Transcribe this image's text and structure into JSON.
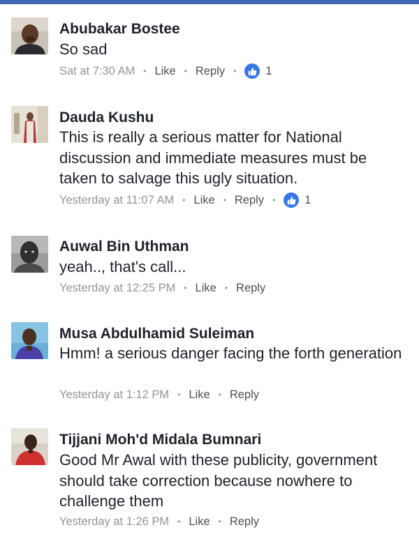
{
  "comments": [
    {
      "name": "Abubakar Bostee",
      "text": "So sad",
      "time": "Sat at 7:30 AM",
      "like_label": "Like",
      "reply_label": "Reply",
      "reactions": "1",
      "reaction_icon": "thumbs-up-icon"
    },
    {
      "name": "Dauda Kushu",
      "text": "This is really a serious matter for National discussion and immediate measures must be taken to salvage this ugly situation.",
      "time": "Yesterday at 11:07 AM",
      "like_label": "Like",
      "reply_label": "Reply",
      "reactions": "1",
      "reaction_icon": "thumbs-up-icon"
    },
    {
      "name": "Auwal Bin Uthman",
      "text": "yeah.., that's call...",
      "time": "Yesterday at 12:25 PM",
      "like_label": "Like",
      "reply_label": "Reply"
    },
    {
      "name": "Musa Abdulhamid Suleiman",
      "text": "Hmm! a serious danger facing the forth generation",
      "time": "Yesterday at 1:12 PM",
      "like_label": "Like",
      "reply_label": "Reply"
    },
    {
      "name": "Tijjani Moh'd Midala Bumnari",
      "text": "Good Mr Awal with these publicity, government should take correction because nowhere to challenge them",
      "time": "Yesterday at 1:26 PM",
      "like_label": "Like",
      "reply_label": "Reply"
    }
  ],
  "separator": "•",
  "colors": {
    "accent": "#4267b2",
    "like_badge": "#3578e5",
    "name_text": "#1d2129",
    "meta_text": "#90949c"
  }
}
